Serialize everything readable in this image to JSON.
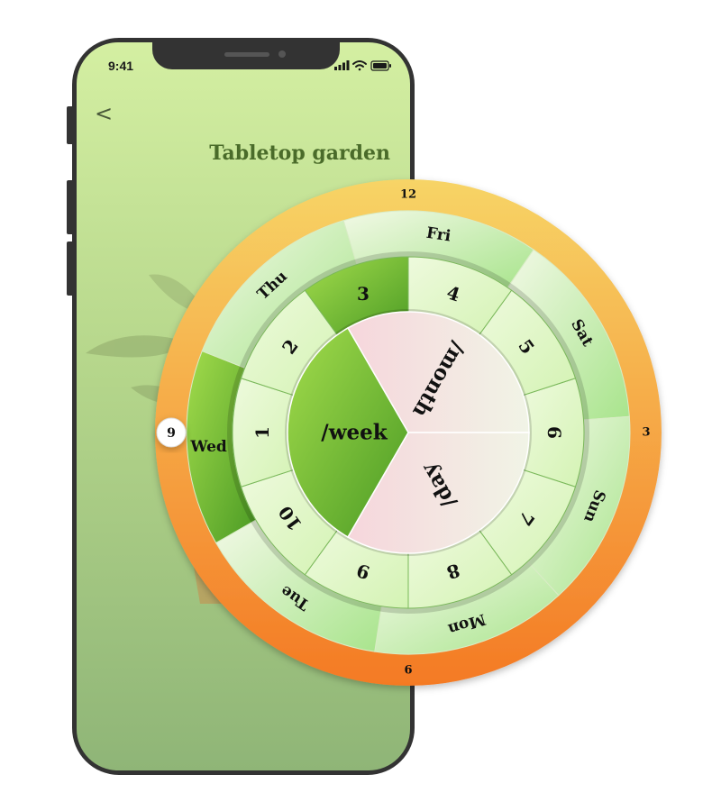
{
  "status": {
    "time": "9:41"
  },
  "header": {
    "back_glyph": "<",
    "title": "Tabletop garden"
  },
  "dial": {
    "outer_numbers": [
      "12",
      "3",
      "6",
      "9"
    ],
    "days": [
      "Fri",
      "Sat",
      "Sun",
      "Mon",
      "Tue",
      "Wed",
      "Thu"
    ],
    "selected_day": "Wed",
    "counts": [
      "6",
      "7",
      "8",
      "9",
      "10",
      "1",
      "2",
      "3",
      "4",
      "5"
    ],
    "selected_count": "3",
    "periods": [
      "/month",
      "/day",
      "/week"
    ],
    "selected_period": "/week",
    "selected_hour": "9"
  },
  "colors": {
    "phone_frame": "#333333",
    "title_green": "#4a6b2a",
    "ring_orange_top": "#f7d466",
    "ring_orange_bottom": "#f47a24",
    "selected_green": "#5fae2c",
    "period_pink": "#f6d6dc"
  }
}
